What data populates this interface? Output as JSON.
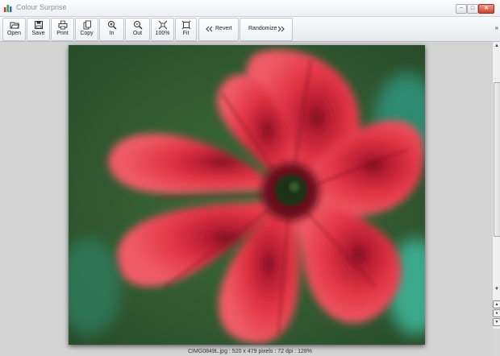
{
  "window": {
    "title": "Colour Surprise",
    "controls": {
      "minimize": "−",
      "maximize": "□",
      "close": "✕"
    }
  },
  "toolbar": {
    "buttons": [
      {
        "label": "Open",
        "icon": "folder-open-icon"
      },
      {
        "label": "Save",
        "icon": "floppy-disk-icon"
      },
      {
        "label": "Print",
        "icon": "printer-icon"
      },
      {
        "label": "Copy",
        "icon": "copy-icon"
      },
      {
        "label": "In",
        "icon": "zoom-in-icon"
      },
      {
        "label": "Out",
        "icon": "zoom-out-icon"
      },
      {
        "label": "100%",
        "icon": "actual-size-icon"
      },
      {
        "label": "Fit",
        "icon": "fit-to-window-icon"
      }
    ],
    "revert_label": "Revert",
    "revert_icon": "double-chevron-left-icon",
    "randomize_label": "Randomize",
    "randomize_icon": "double-chevron-right-icon",
    "overflow_label": "»"
  },
  "image": {
    "subject": "red-petunia-flower-photo",
    "colors": {
      "petal": "#e0303f",
      "petal_dark": "#8c1525",
      "background": "#2f5a30",
      "center": "#1f3316"
    }
  },
  "scrollbar": {
    "up": "▲",
    "down": "▼"
  },
  "status": {
    "text": "CIMG0849L.jpg : 520 x 479 pixels : 72 dpi : 128%"
  }
}
